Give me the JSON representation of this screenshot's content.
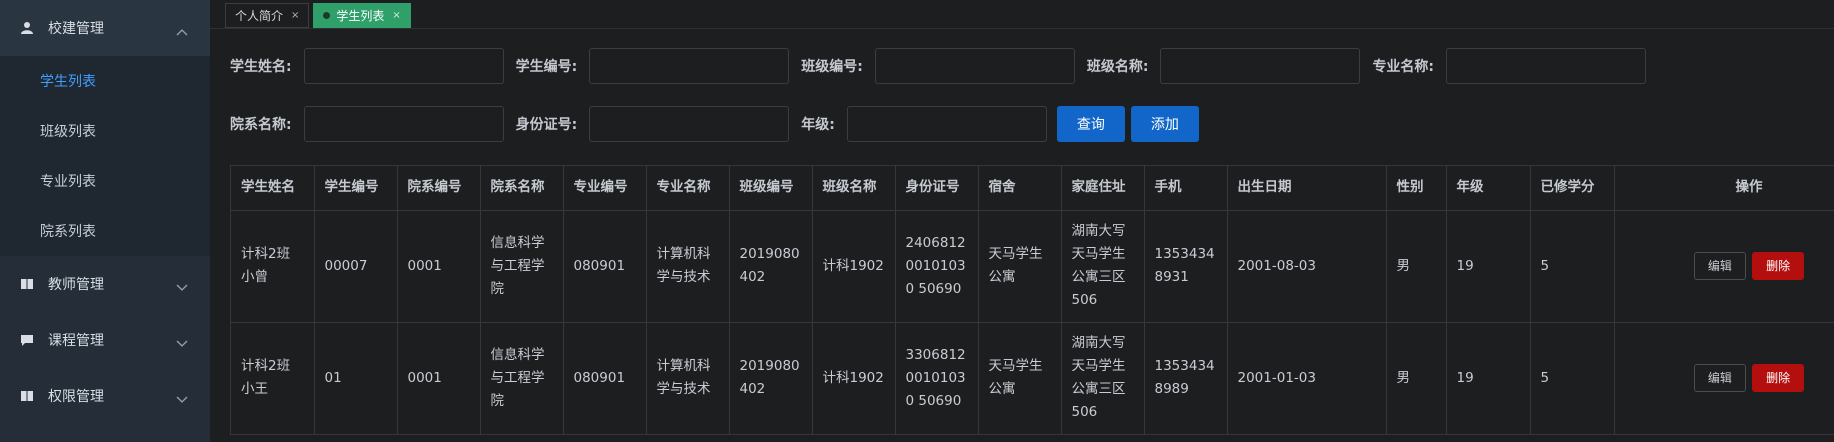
{
  "sidebar": {
    "groups": [
      {
        "label": "校建管理",
        "icon": "user-icon",
        "open": true
      },
      {
        "label": "教师管理",
        "icon": "book-icon"
      },
      {
        "label": "课程管理",
        "icon": "message-icon"
      },
      {
        "label": "权限管理",
        "icon": "book-icon"
      }
    ],
    "sub_items": [
      {
        "label": "学生列表",
        "active": true
      },
      {
        "label": "班级列表"
      },
      {
        "label": "专业列表"
      },
      {
        "label": "院系列表"
      }
    ]
  },
  "tabs": [
    {
      "label": "个人简介",
      "close": "×"
    },
    {
      "label": "学生列表",
      "close": "×",
      "active": true
    }
  ],
  "search": {
    "student_name_label": "学生姓名:",
    "student_no_label": "学生编号:",
    "class_no_label": "班级编号:",
    "class_name_label": "班级名称:",
    "major_name_label": "专业名称:",
    "dept_name_label": "院系名称:",
    "id_card_label": "身份证号:",
    "grade_label": "年级:",
    "query_button": "查询",
    "add_button": "添加"
  },
  "table": {
    "headers": [
      "学生姓名",
      "学生编号",
      "院系编号",
      "院系名称",
      "专业编号",
      "专业名称",
      "班级编号",
      "班级名称",
      "身份证号",
      "宿舍",
      "家庭住址",
      "手机",
      "出生日期",
      "性别",
      "年级",
      "已修学分",
      "操作"
    ],
    "rows": [
      [
        "计科2班小曾",
        "00007",
        "0001",
        "信息科学与工程学院",
        "080901",
        "计算机科学与技术",
        "2019080402",
        "计科1902",
        "240681200101030 50690",
        "天马学生公寓",
        "湖南大写天马学生公寓三区506",
        "13534348931",
        "2001-08-03",
        "男",
        "19",
        "5"
      ],
      [
        "计科2班小王",
        "01",
        "0001",
        "信息科学与工程学院",
        "080901",
        "计算机科学与技术",
        "2019080402",
        "计科1902",
        "330681200101030 50690",
        "天马学生公寓",
        "湖南大写天马学生公寓三区506",
        "13534348989",
        "2001-01-03",
        "男",
        "19",
        "5"
      ]
    ],
    "edit_label": "编辑",
    "delete_label": "删除"
  },
  "colors": {
    "sidebar_bg": "#242d38",
    "active_blue": "#409eff",
    "tab_active": "#2fa06a",
    "primary_button": "#1366c9",
    "danger_button": "#b30f0f"
  }
}
